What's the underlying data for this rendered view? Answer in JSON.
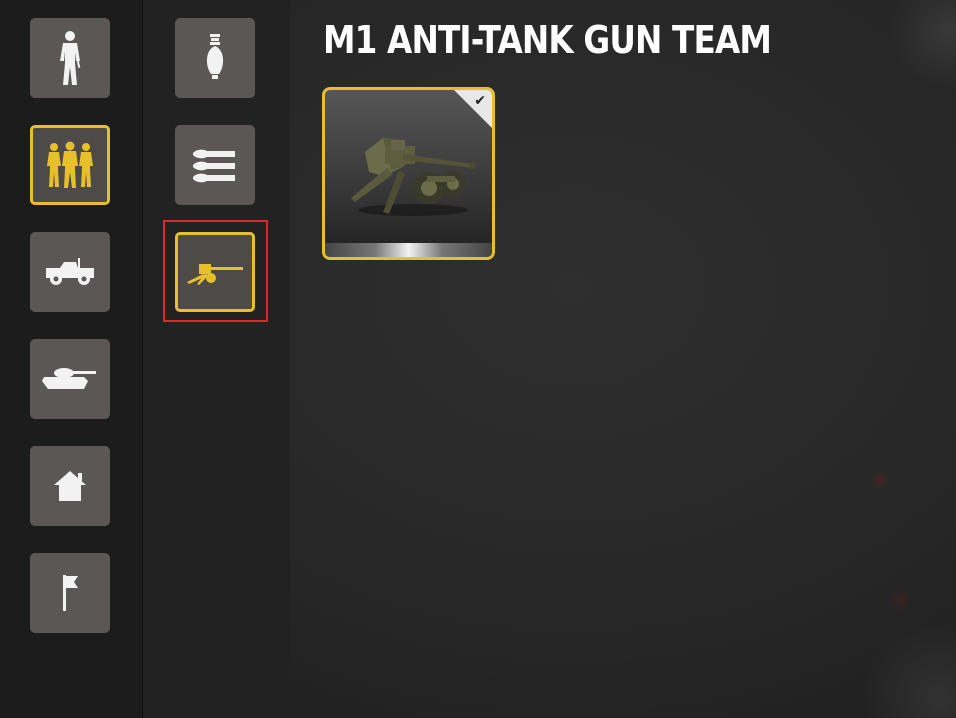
{
  "header": {
    "title": "M1 ANTI-TANK GUN TEAM"
  },
  "categories": [
    {
      "icon": "infantry-soldier-icon",
      "active": false
    },
    {
      "icon": "squad-icon",
      "active": true
    },
    {
      "icon": "jeep-icon",
      "active": false
    },
    {
      "icon": "tank-icon",
      "active": false
    },
    {
      "icon": "building-icon",
      "active": false
    },
    {
      "icon": "flag-icon",
      "active": false
    }
  ],
  "subcategories": [
    {
      "icon": "mortar-shell-icon",
      "active": false
    },
    {
      "icon": "ammunition-icon",
      "active": false
    },
    {
      "icon": "anti-tank-gun-icon",
      "active": true
    }
  ],
  "unit_card": {
    "icon": "m1-anti-tank-gun-image",
    "selected": true,
    "check_icon": "checkmark-icon"
  },
  "colors": {
    "accent": "#e6c02b",
    "button": "#5a5756",
    "highlight": "#e0262b",
    "background": "#272727"
  }
}
